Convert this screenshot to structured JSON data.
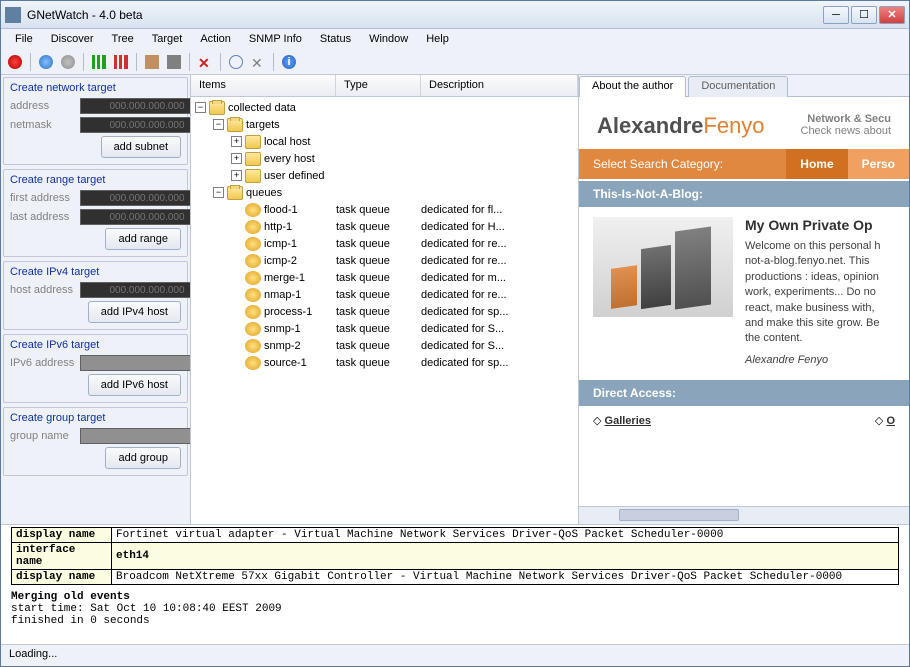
{
  "window": {
    "title": "GNetWatch - 4.0 beta"
  },
  "menubar": [
    "File",
    "Discover",
    "Tree",
    "Target",
    "Action",
    "SNMP Info",
    "Status",
    "Window",
    "Help"
  ],
  "leftpane": {
    "groups": [
      {
        "title": "Create network target",
        "fields": [
          {
            "label": "address",
            "placeholder": "000.000.000.000"
          },
          {
            "label": "netmask",
            "placeholder": "000.000.000.000"
          }
        ],
        "button": "add subnet"
      },
      {
        "title": "Create range target",
        "fields": [
          {
            "label": "first address",
            "placeholder": "000.000.000.000"
          },
          {
            "label": "last address",
            "placeholder": "000.000.000.000"
          }
        ],
        "button": "add range"
      },
      {
        "title": "Create IPv4 target",
        "fields": [
          {
            "label": "host address",
            "placeholder": "000.000.000.000"
          }
        ],
        "button": "add IPv4 host"
      },
      {
        "title": "Create IPv6 target",
        "fields": [
          {
            "label": "IPv6 address",
            "placeholder": "",
            "light": true
          }
        ],
        "button": "add IPv6 host"
      },
      {
        "title": "Create group target",
        "fields": [
          {
            "label": "group name",
            "placeholder": "",
            "light": true
          }
        ],
        "button": "add group"
      }
    ]
  },
  "tree": {
    "headers": {
      "items": "Items",
      "type": "Type",
      "desc": "Description"
    },
    "root": {
      "label": "collected data",
      "children": [
        {
          "label": "targets",
          "children": [
            {
              "label": "local host"
            },
            {
              "label": "every host"
            },
            {
              "label": "user defined"
            }
          ]
        },
        {
          "label": "queues",
          "children": [
            {
              "label": "flood-1",
              "type": "task queue",
              "desc": "dedicated for fl..."
            },
            {
              "label": "http-1",
              "type": "task queue",
              "desc": "dedicated for H..."
            },
            {
              "label": "icmp-1",
              "type": "task queue",
              "desc": "dedicated for re..."
            },
            {
              "label": "icmp-2",
              "type": "task queue",
              "desc": "dedicated for re..."
            },
            {
              "label": "merge-1",
              "type": "task queue",
              "desc": "dedicated for m..."
            },
            {
              "label": "nmap-1",
              "type": "task queue",
              "desc": "dedicated for re..."
            },
            {
              "label": "process-1",
              "type": "task queue",
              "desc": "dedicated for sp..."
            },
            {
              "label": "snmp-1",
              "type": "task queue",
              "desc": "dedicated for S..."
            },
            {
              "label": "snmp-2",
              "type": "task queue",
              "desc": "dedicated for S..."
            },
            {
              "label": "source-1",
              "type": "task queue",
              "desc": "dedicated for sp..."
            }
          ]
        }
      ]
    }
  },
  "rightpane": {
    "tabs": [
      {
        "label": "About the author",
        "active": true
      },
      {
        "label": "Documentation",
        "active": false
      }
    ],
    "web": {
      "name1": "Alexandre",
      "name2": "Fenyo",
      "tagline1": "Network & Secu",
      "tagline2": "Check news about",
      "nav_label": "Select Search Category:",
      "nav_home": "Home",
      "nav_perso": "Perso",
      "section1": "This-Is-Not-A-Blog:",
      "post_title": "My Own Private Op",
      "post_body": "Welcome on this personal h not-a-blog.fenyo.net. This productions : ideas, opinion work, experiments... Do no react, make business with, and make this site grow. Be the content.",
      "post_sig": "Alexandre Fenyo",
      "section2": "Direct Access:",
      "link1": "Galleries",
      "link2": "O"
    }
  },
  "log": {
    "row1_k": "display name",
    "row1_v": "Fortinet virtual adapter - Virtual Machine Network Services Driver-QoS Packet Scheduler-0000",
    "row2_k": "interface name",
    "row2_v": "eth14",
    "row3_k": "display name",
    "row3_v": "Broadcom NetXtreme 57xx Gigabit Controller - Virtual Machine Network Services Driver-QoS Packet Scheduler-0000",
    "merge": "Merging old events",
    "start": "start time: Sat Oct 10 10:08:40 EEST 2009",
    "finish": "finished in 0 seconds"
  },
  "status": "Loading..."
}
